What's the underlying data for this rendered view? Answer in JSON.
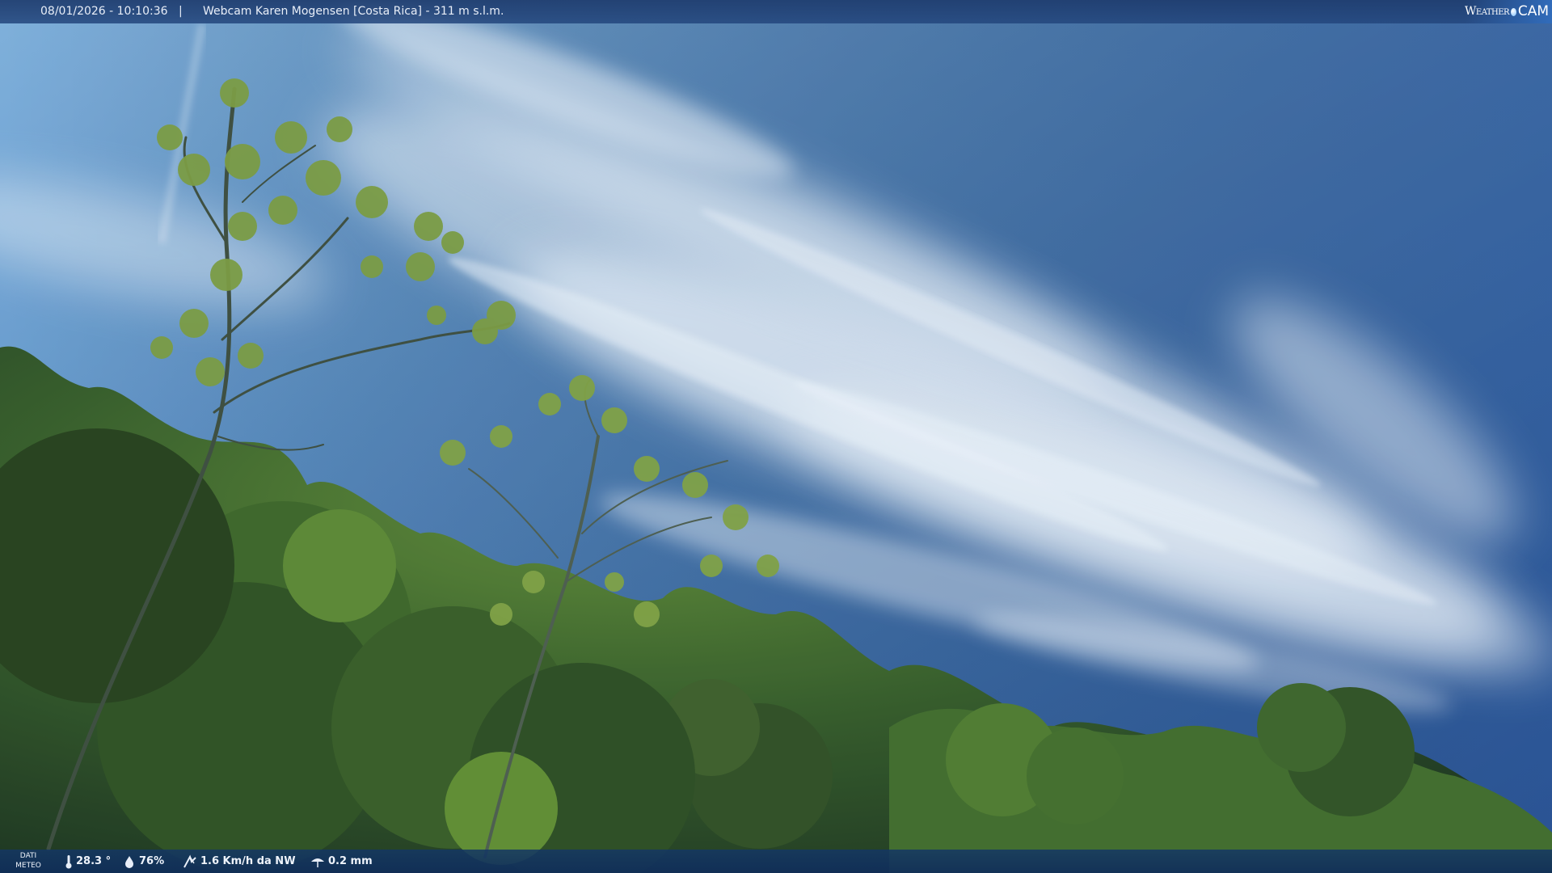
{
  "top_bar": {
    "timestamp": "08/01/2026 - 10:10:36",
    "separator": "|",
    "camera_title": "Webcam Karen Mogensen [Costa Rica] - 311 m s.l.m.",
    "logo_word": "Weather",
    "logo_cam": "CAM"
  },
  "bottom_bar": {
    "dati_line1": "DATI",
    "dati_line2": "METEO",
    "temperature": "28.3 °",
    "humidity": "76%",
    "wind": "1.6 Km/h da NW",
    "rain": "0.2 mm",
    "icons": [
      "thermometer-icon",
      "humidity-drop-icon",
      "wind-icon",
      "rain-gauge-icon"
    ]
  },
  "colors": {
    "sky_top": "#2e5c9e",
    "sky_mid": "#5f93c8",
    "cloud": "#e8f0f8",
    "foliage_dark": "#1e3a1c",
    "foliage_light": "#6e9a3a",
    "bar": "#1e3c6e"
  }
}
